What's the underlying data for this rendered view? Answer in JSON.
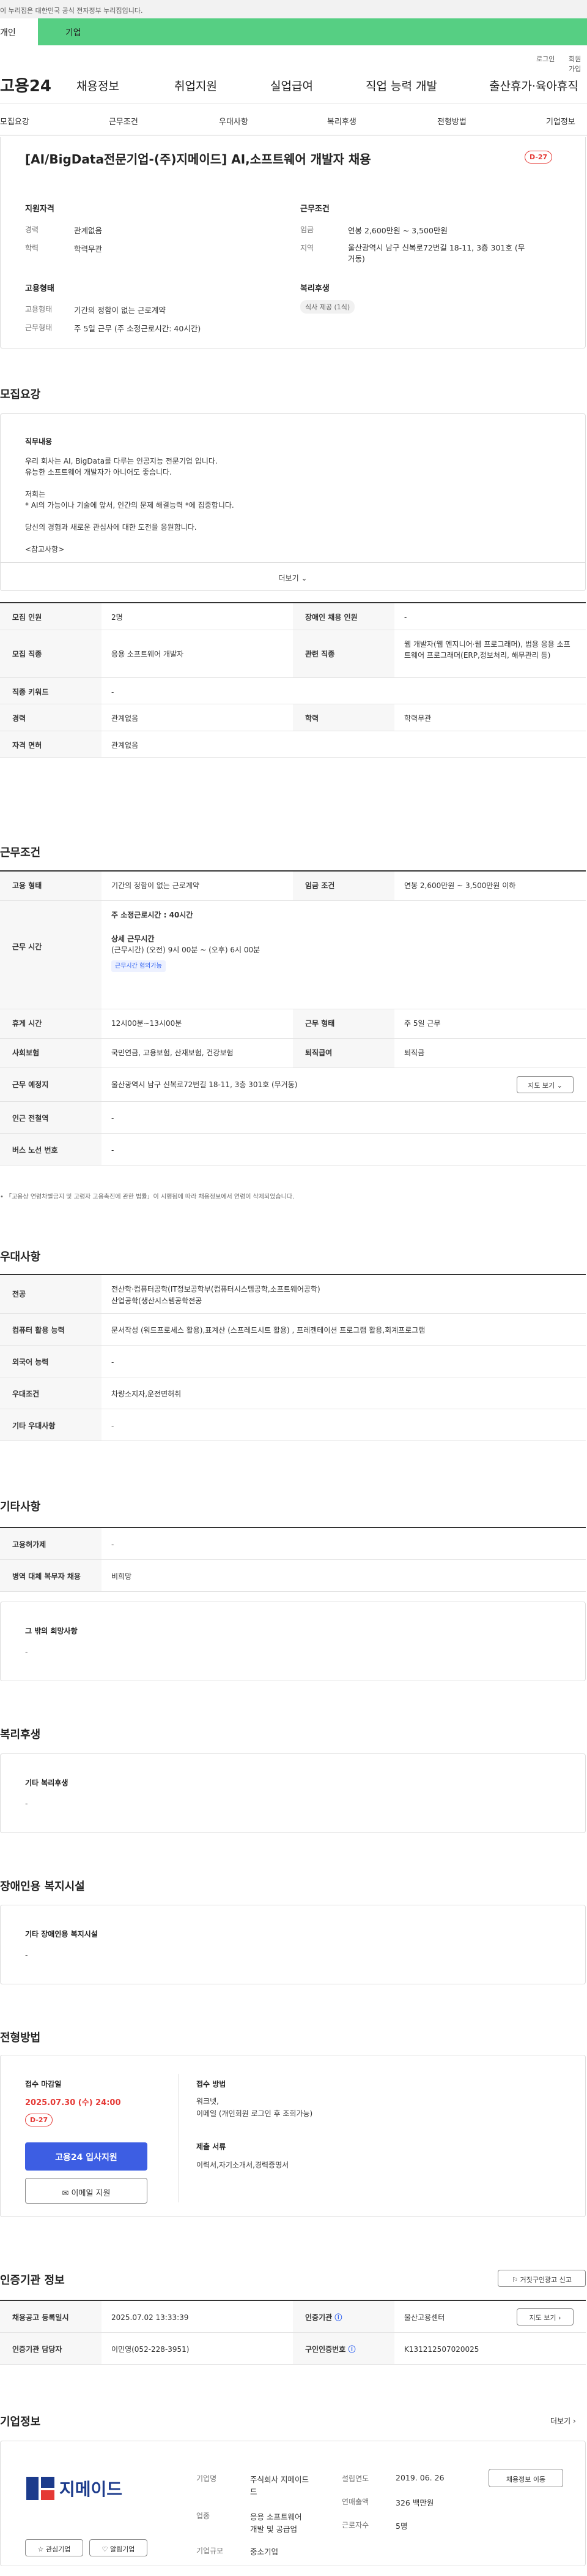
{
  "gov_notice": "이 누리집은 대한민국 공식 전자정부 누리집입니다.",
  "top_tabs": [
    "개인",
    "기업"
  ],
  "util": {
    "login": "로그인",
    "join": "회원가입"
  },
  "gnb": {
    "logo": "고용24",
    "items": [
      "채용정보",
      "취업지원",
      "실업급여",
      "직업 능력 개발",
      "출산휴가·육아휴직"
    ]
  },
  "subnav": [
    "모집요강",
    "근무조건",
    "우대사항",
    "복리후생",
    "전형방법",
    "기업정보"
  ],
  "job": {
    "title": "[AI/BigData전문기업-(주)지메이드] AI,소프트웨어 개발자 채용",
    "dday": "D-27",
    "qual_title": "지원자격",
    "career_l": "경력",
    "career_v": "관계없음",
    "edu_l": "학력",
    "edu_v": "학력무관",
    "cond_title": "근무조건",
    "wage_l": "임금",
    "wage_v": "연봉 2,600만원 ~ 3,500만원",
    "area_l": "지역",
    "area_v1": "울산광역시 남구 신복로72번길 18-11, 3층 301호 (무",
    "area_v2": "거동)",
    "type_title": "고용형태",
    "emp_l": "고용형태",
    "emp_v": "기간의 정함이 없는 근로계약",
    "work_l": "근무형태",
    "work_v": "주 5일 근무 (주 소정근로시간: 40시간)",
    "welfare_title": "복리후생",
    "welfare_v": "식사 제공 (1식)"
  },
  "recruit": {
    "section": "모집요강",
    "desc_title": "직무내용",
    "desc": [
      "우리 회사는 AI, BigData를 다루는 인공지능 전문기업 입니다.",
      "유능한 소프트웨어 개발자가 아니어도 좋습니다.",
      "",
      "저희는",
      "* AI의 가능이나 기술에 앞서, 인간의 문제 해결능력 *에 집중합니다.",
      "",
      "당신의 경험과 새로운 관심사에 대한 도전을 응원합니다.",
      "",
      "<참고사항>"
    ],
    "more": "더보기",
    "rows": [
      [
        "모집 인원",
        "2명",
        "장애인 채용 인원",
        "-"
      ],
      [
        "모집 직종",
        "응용 소프트웨어 개발자",
        "관련 직종",
        "웹 개발자(웹 엔지니어·웹 프로그래머), 범용 응용 소프트웨어 프로그래머(ERP,정보처리, 해무관리 등)"
      ]
    ],
    "full": [
      [
        "직종 키워드",
        "-"
      ]
    ],
    "rows2": [
      [
        "경력",
        "관계없음",
        "학력",
        "학력무관"
      ]
    ],
    "full2": [
      [
        "자격 면허",
        "관계없음"
      ]
    ]
  },
  "cond": {
    "section": "근무조건",
    "emp_l": "고용 형태",
    "emp_v": "기간의 정함이 없는 근로계약",
    "wage_l": "임금 조건",
    "wage_v": "연봉 2,600만원 ~ 3,500만원 이하",
    "time_l": "근무 시간",
    "time1": "주 소정근로시간 : 40시간",
    "time2": "상세 근무시간",
    "time3": "(근무시간) (오전) 9시 00분 ~ (오후) 6시 00분",
    "time_chip": "근무시간 협의가능",
    "rest_l": "휴게 시간",
    "rest_v": "12시00분~13시00분",
    "form_l": "근무 형태",
    "form_v": "주 5일 근무",
    "ins_l": "사회보험",
    "ins_v": "국민연금, 고용보험, 산재보험, 건강보험",
    "sev_l": "퇴직급여",
    "sev_v": "퇴직금",
    "place_l": "근무 예정지",
    "place_v": "울산광역시 남구 신복로72번길 18-11, 3층 301호 (무거동)",
    "map_btn": "지도 보기",
    "subway_l": "인근 전철역",
    "subway_v": "-",
    "bus_l": "버스 노선 번호",
    "bus_v": "-",
    "note": "「고용상 연령차별금지 및 고령자 고용촉진에 관한 법률」이 시행됨에 따라 채용정보에서 연령이 삭제되었습니다."
  },
  "pref": {
    "section": "우대사항",
    "major_l": "전공",
    "major_v1": "전산학·컴퓨터공학(IT정보공학부(컴퓨터시스템공학,소프트웨어공학)",
    "major_v2": "산업공학(생산시스템공학전공",
    "comp_l": "컴퓨터 활용 능력",
    "comp_v": "문서작성 (워드프로세스 활용),표계산 (스프레드시트 활용) , 프레젠테이션 프로그램 활용,회계프로그램",
    "lang_l": "외국어 능력",
    "lang_v": "-",
    "cond_l": "우대조건",
    "cond_v": "차량소지자,운전면허취",
    "etc_l": "기타 우대사항",
    "etc_v": "-"
  },
  "etc": {
    "section": "기타사항",
    "dis_l": "고용허가제",
    "dis_v": "-",
    "mil_l": "병역 대체 복무자 채용",
    "mil_v": "비희망",
    "box_title": "그 밖의 희망사항",
    "box_v": "-"
  },
  "welfare": {
    "section": "복리후생",
    "title": "기타 복리후생",
    "v": "-"
  },
  "disab": {
    "section": "장애인용 복지시설",
    "title": "기타 장애인용 복지시설",
    "v": "-"
  },
  "screen": {
    "section": "전형방법",
    "deadline_l": "접수 마감일",
    "deadline_v": "2025.07.30 (수) 24:00",
    "dday": "D-27",
    "apply_btn": "고용24 입사지원",
    "email_btn": "이메일 지원",
    "method_l": "접수 방법",
    "method_v1": "워크넷,",
    "method_v2": "이메일 (개인회원 로그인 후 조회가능)",
    "docs_l": "제출 서류",
    "docs_v": "이력서,자기소개서,경력증명서"
  },
  "cert": {
    "section": "인증기관 정보",
    "report_btn": "거짓구인광고 신고",
    "reg_l": "채용공고 등록일시",
    "reg_v": "2025.07.02 13:33:39",
    "org_l": "인증기관",
    "org_v": "울산고용센터",
    "map_btn": "지도 보기",
    "mgr_l": "인증기관 담당자",
    "mgr_v": "이민영(052-228-3951)",
    "num_l": "구인인증번호",
    "num_v": "K131212507020025"
  },
  "company": {
    "section": "기업정보",
    "more": "더보기",
    "logo_text": "지메이드",
    "fav_btn": "관심기업",
    "alarm_btn": "알림기업",
    "name_l": "기업명",
    "name_v1": "주식회사 지메이드",
    "name_v2": "드",
    "biz_l": "업종",
    "biz_v1": "응용 소프트웨어",
    "biz_v2": "개발 및 공급업",
    "size_l": "기업규모",
    "size_v": "중소기업",
    "est_l": "설립연도",
    "est_v": "2019. 06. 26",
    "sales_l": "연매출액",
    "sales_v": "326 백만원",
    "emp_l": "근로자수",
    "emp_v": "5명",
    "jobs_btn": "채용정보 이동"
  }
}
